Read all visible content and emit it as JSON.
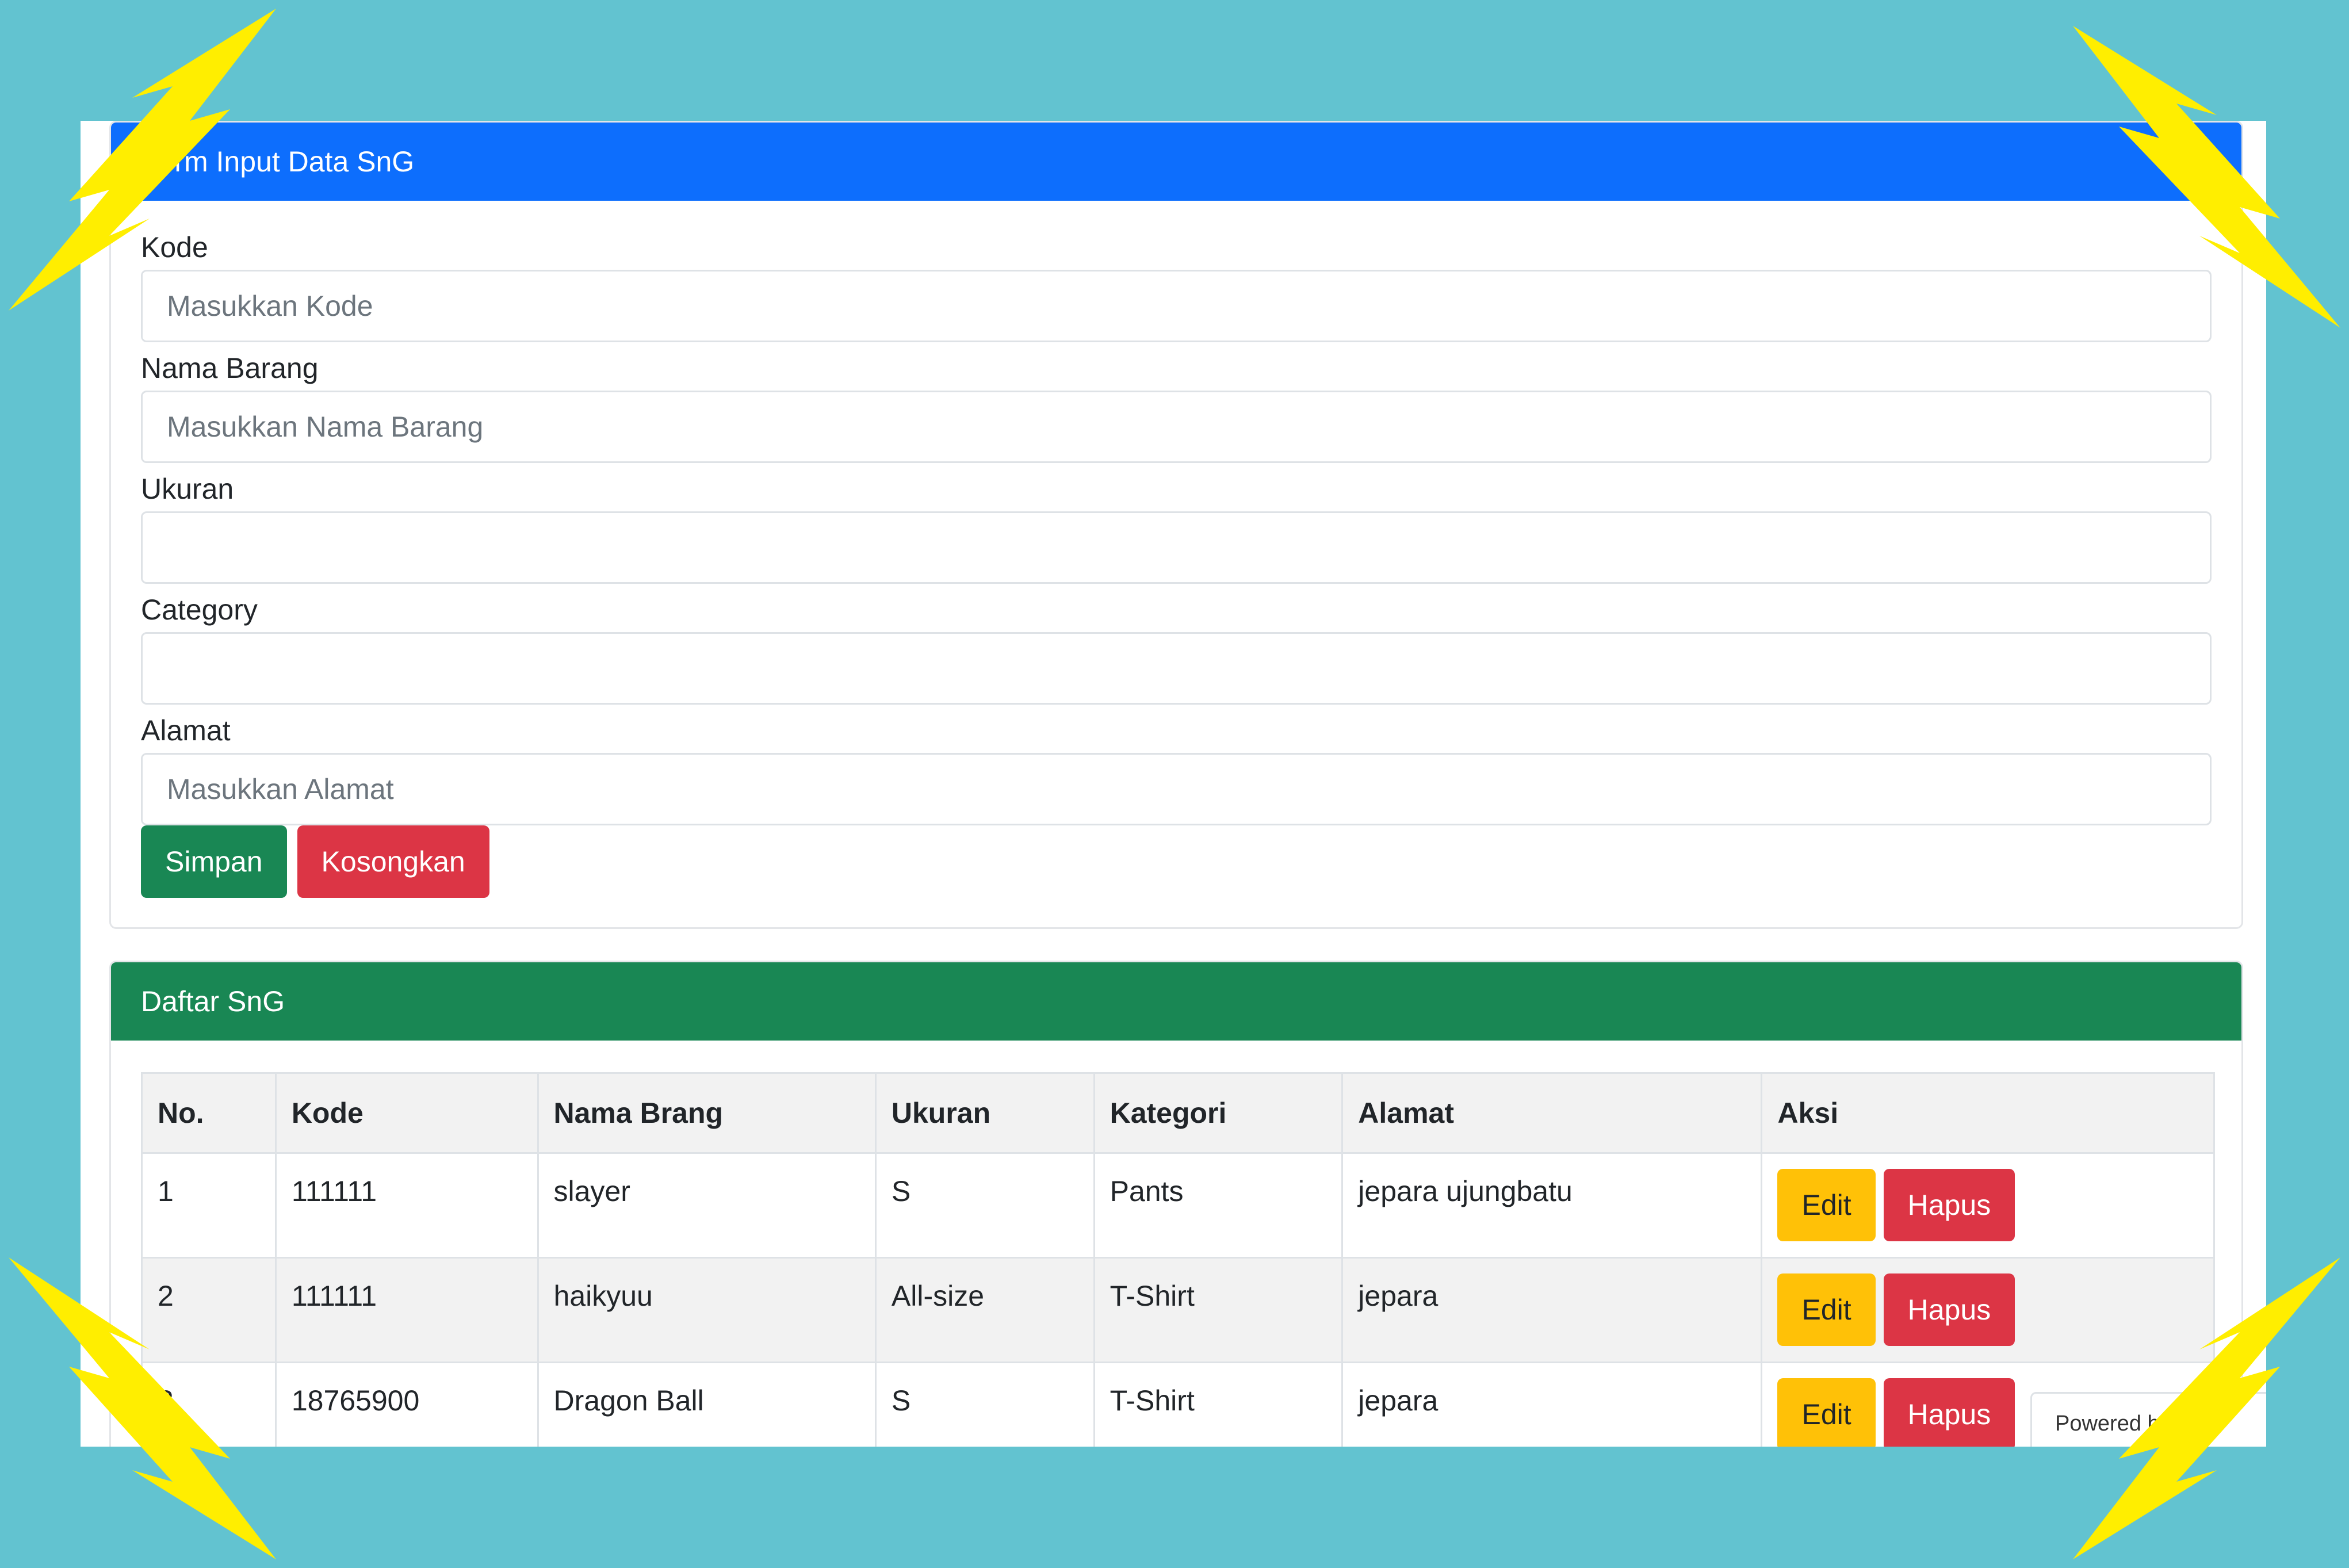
{
  "form_card": {
    "title": "Form Input Data SnG",
    "fields": [
      {
        "label": "Kode",
        "placeholder": "Masukkan Kode"
      },
      {
        "label": "Nama Barang",
        "placeholder": "Masukkan Nama Barang"
      },
      {
        "label": "Ukuran",
        "placeholder": ""
      },
      {
        "label": "Category",
        "placeholder": ""
      },
      {
        "label": "Alamat",
        "placeholder": "Masukkan Alamat"
      }
    ],
    "save_label": "Simpan",
    "clear_label": "Kosongkan"
  },
  "list_card": {
    "title": "Daftar SnG",
    "columns": [
      "No.",
      "Kode",
      "Nama Brang",
      "Ukuran",
      "Kategori",
      "Alamat",
      "Aksi"
    ],
    "rows": [
      {
        "no": "1",
        "kode": "111111",
        "nama": "slayer",
        "ukuran": "S",
        "kategori": "Pants",
        "alamat": "jepara ujungbatu"
      },
      {
        "no": "2",
        "kode": "111111",
        "nama": "haikyuu",
        "ukuran": "All-size",
        "kategori": "T-Shirt",
        "alamat": "jepara"
      },
      {
        "no": "3",
        "kode": "18765900",
        "nama": "Dragon Ball",
        "ukuran": "S",
        "kategori": "T-Shirt",
        "alamat": "jepara"
      }
    ],
    "edit_label": "Edit",
    "delete_label": "Hapus"
  },
  "powered_badge": "Powered by",
  "colors": {
    "background": "#62c3d0",
    "primary": "#0d6efd",
    "success": "#198754",
    "danger": "#dc3545",
    "warning": "#ffc107",
    "decoration": "#ffee00"
  }
}
